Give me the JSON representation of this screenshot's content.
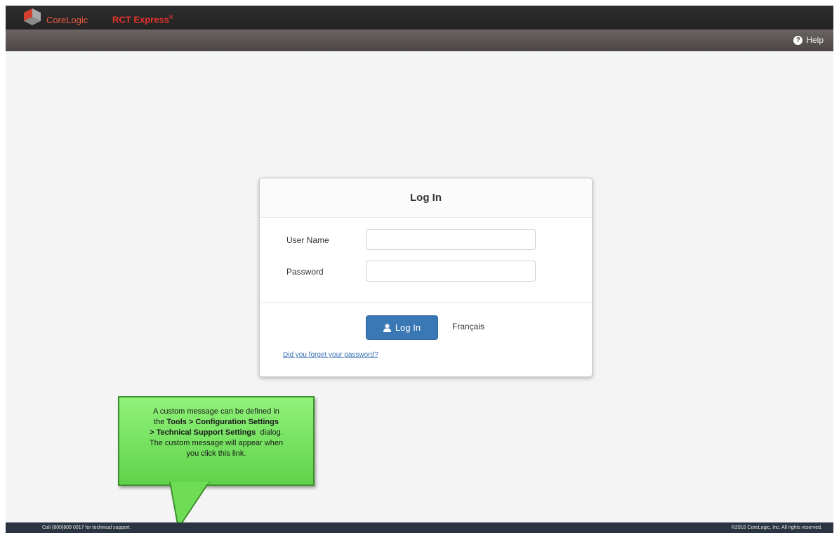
{
  "header": {
    "brand_name": "CoreLogic",
    "product_name": "RCT Express",
    "product_mark": "®",
    "help_label": "Help",
    "brand_color": "#e8332b"
  },
  "login": {
    "title": "Log In",
    "username_label": "User Name",
    "username_value": "",
    "password_label": "Password",
    "password_value": "",
    "login_button": "Log In",
    "language_link": "Français",
    "forgot_link": "Did you forget your password?",
    "button_color": "#3a78b5"
  },
  "callout": {
    "line1": "A custom message can be defined in",
    "line2_pre": "the ",
    "line2_bold": "Tools > Configuration Settings",
    "line3_bold": "> Technical Support Settings",
    "line3_post": "  dialog.",
    "line4": "The custom message will appear when",
    "line5": "you click this link.",
    "color": "#6fdc56"
  },
  "footer": {
    "support_text": "Call (800)809 0017 for technical support.",
    "copyright": "©2016 CoreLogic, Inc. All rights reserved."
  },
  "icons": [
    "corelogic-logo-icon",
    "help-icon",
    "user-icon"
  ]
}
